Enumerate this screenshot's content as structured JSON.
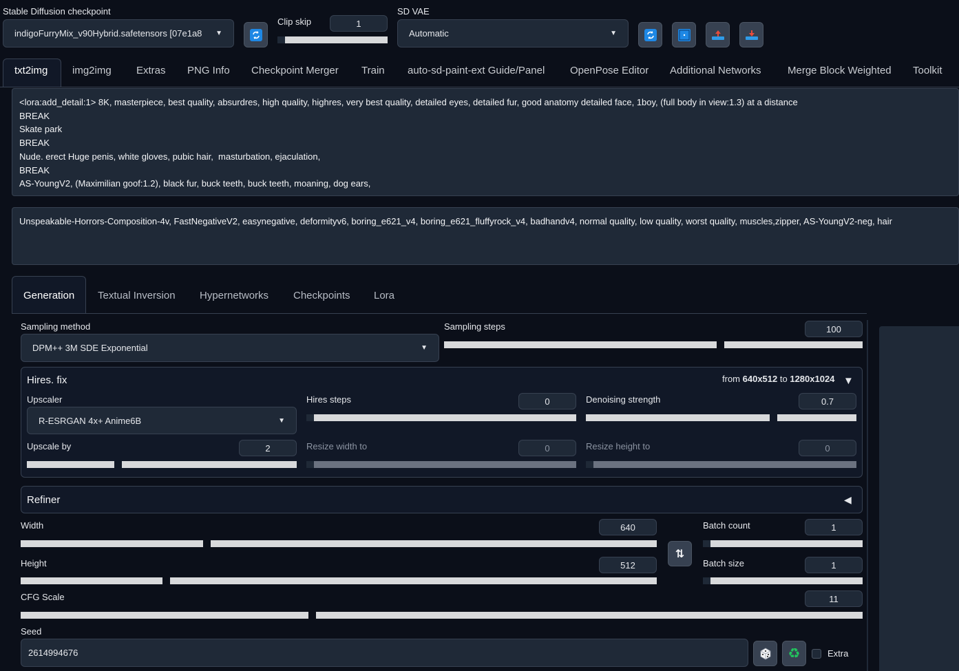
{
  "top": {
    "checkpoint_label": "Stable Diffusion checkpoint",
    "checkpoint_value": "indigoFurryMix_v90Hybrid.safetensors [07e1a8",
    "clip_skip_label": "Clip skip",
    "clip_skip_value": "1",
    "clip_skip_fill": 1.0,
    "sd_vae_label": "SD VAE",
    "sd_vae_value": "Automatic"
  },
  "tabs": [
    "txt2img",
    "img2img",
    "Extras",
    "PNG Info",
    "Checkpoint Merger",
    "Train",
    "auto-sd-paint-ext Guide/Panel",
    "OpenPose Editor",
    "Additional Networks",
    "Merge Block Weighted",
    "Toolkit"
  ],
  "prompt": "<lora:add_detail:1> 8K, masterpiece, best quality, absurdres, high quality, highres, very best quality, detailed eyes, detailed fur, good anatomy detailed face, 1boy, (full body in view:1.3) at a distance\nBREAK\nSkate park\nBREAK\nNude. erect Huge penis, white gloves, pubic hair,  masturbation, ejaculation,\nBREAK\nAS-YoungV2, (Maximilian goof:1.2), black fur, buck teeth, buck teeth, moaning, dog ears,",
  "negative_prompt": "Unspeakable-Horrors-Composition-4v, FastNegativeV2, easynegative, deformityv6, boring_e621_v4, boring_e621_fluffyrock_v4, badhandv4, normal quality, low quality, worst quality, muscles,zipper, AS-YoungV2-neg, hair",
  "subtabs": [
    "Generation",
    "Textual Inversion",
    "Hypernetworks",
    "Checkpoints",
    "Lora"
  ],
  "sampling": {
    "method_label": "Sampling method",
    "method_value": "DPM++ 3M SDE Exponential",
    "steps_label": "Sampling steps",
    "steps_value": "100"
  },
  "hires": {
    "title": "Hires. fix",
    "from_prefix": "from",
    "from_size": "640x512",
    "to_prefix": "to",
    "to_size": "1280x1024",
    "upscaler_label": "Upscaler",
    "upscaler_value": "R-ESRGAN 4x+ Anime6B",
    "steps_label": "Hires steps",
    "steps_value": "0",
    "denoise_label": "Denoising strength",
    "denoise_value": "0.7",
    "upscale_by_label": "Upscale by",
    "upscale_by_value": "2",
    "resize_w_label": "Resize width to",
    "resize_w_value": "0",
    "resize_h_label": "Resize height to",
    "resize_h_value": "0"
  },
  "refiner": {
    "title": "Refiner"
  },
  "size": {
    "width_label": "Width",
    "width_value": "640",
    "height_label": "Height",
    "height_value": "512",
    "batch_count_label": "Batch count",
    "batch_count_value": "1",
    "batch_size_label": "Batch size",
    "batch_size_value": "1"
  },
  "cfg": {
    "label": "CFG Scale",
    "value": "11"
  },
  "seed": {
    "label": "Seed",
    "value": "2614994676",
    "extra_label": "Extra"
  },
  "colors": {
    "bg": "#0b0f19",
    "panel": "#1f2937",
    "track": "#d8d9db",
    "icon_blue": "#1e88e5",
    "recycle_green": "#22c55e"
  }
}
